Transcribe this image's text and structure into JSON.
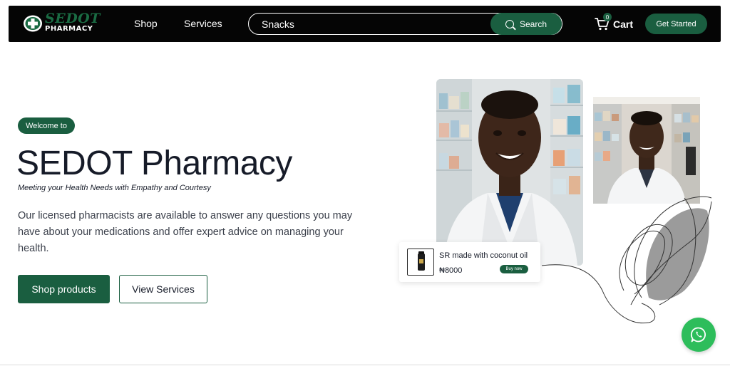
{
  "navbar": {
    "logo_top": "SEDOT",
    "logo_bottom": "PHARMACY",
    "links": [
      "Shop",
      "Services"
    ],
    "search": {
      "value": "Snacks",
      "placeholder": "Snacks",
      "button_label": "Search"
    },
    "cart": {
      "label": "Cart",
      "count": "0"
    },
    "cta_label": "Get Started"
  },
  "hero": {
    "badge": "Welcome to",
    "title": "SEDOT Pharmacy",
    "tagline": "Meeting your Health Needs with Empathy and Courtesy",
    "description": "Our licensed pharmacists are available to answer any questions you may have about your medications and offer expert advice on managing your health.",
    "primary_button": "Shop products",
    "secondary_button": "View Services"
  },
  "product_card": {
    "name": "SR made with coconut oil",
    "price": "₦8000",
    "button": "Buy now"
  },
  "colors": {
    "brand_green": "#1a5e40",
    "navbar_bg": "#050505",
    "whatsapp_green": "#2dbd5b"
  },
  "icons": [
    "pharmacy-cross-icon",
    "search-icon",
    "cart-icon",
    "whatsapp-icon"
  ]
}
